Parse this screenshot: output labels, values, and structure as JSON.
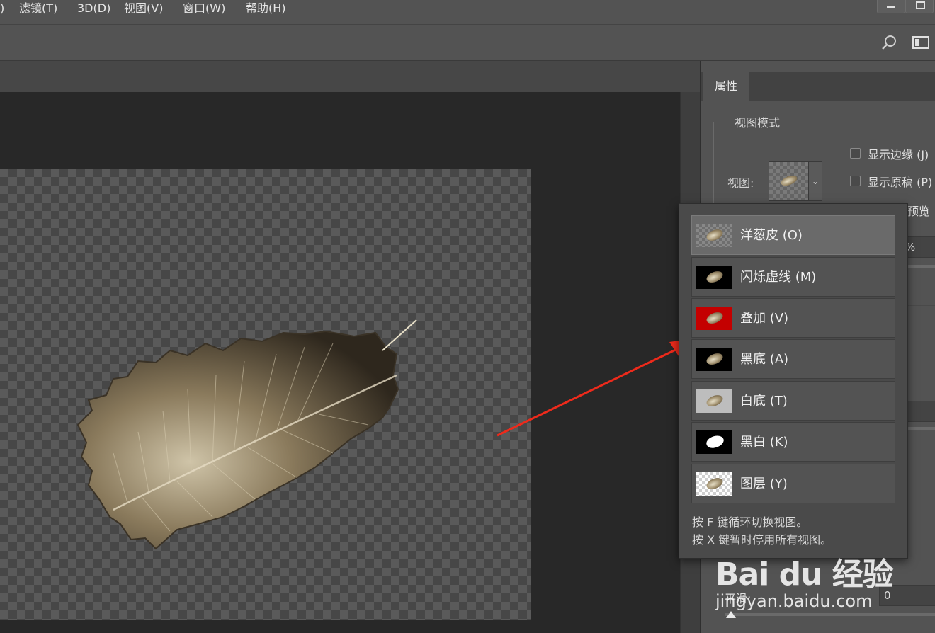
{
  "menu": {
    "partial": ")",
    "items": [
      "滤镜(T)",
      "3D(D)",
      "视图(V)",
      "窗口(W)",
      "帮助(H)"
    ]
  },
  "properties_panel": {
    "tab": "属性",
    "view_mode_title": "视图模式",
    "view_label": "视图:",
    "show_edge": "显示边缘 (J)",
    "show_original": "显示原稿 (P)",
    "preview_partial": "预览",
    "percent_partial": "%",
    "smooth_label": "平滑:",
    "smooth_value": "0"
  },
  "view_popup": {
    "options": [
      {
        "label": "洋葱皮 (O)",
        "thumb": "onion-skin",
        "selected": true
      },
      {
        "label": "闪烁虚线 (M)",
        "thumb": "black",
        "selected": false
      },
      {
        "label": "叠加 (V)",
        "thumb": "red",
        "selected": false
      },
      {
        "label": "黑底 (A)",
        "thumb": "black",
        "selected": false
      },
      {
        "label": "白底 (T)",
        "thumb": "white",
        "selected": false
      },
      {
        "label": "黑白 (K)",
        "thumb": "black-white-mask",
        "selected": false
      },
      {
        "label": "图层 (Y)",
        "thumb": "layer-transparent",
        "selected": false
      }
    ],
    "hint_cycle": "按 F 键循环切换视图。",
    "hint_disable": "按 X 键暂时停用所有视图。"
  },
  "watermark": {
    "logo": "Bai du 经验",
    "url": "jingyan.baidu.com"
  },
  "colors": {
    "accent_arrow": "#ee2a1b",
    "overlay_red": "#c40000",
    "panel_bg": "#535353",
    "canvas_bg": "#282828"
  }
}
